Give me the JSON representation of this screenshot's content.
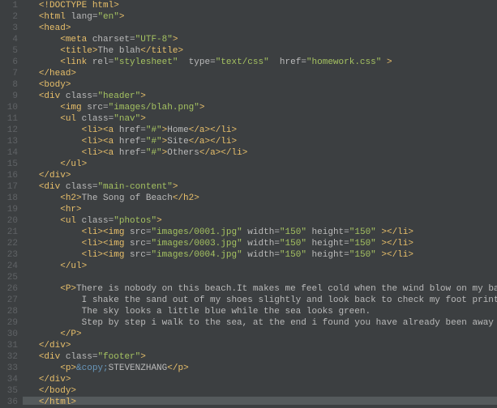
{
  "file": {
    "line_count": 36,
    "current_line": 36
  },
  "code_lines": [
    {
      "indent": 0,
      "tokens": [
        [
          "t-tag",
          "<!DOCTYPE html>"
        ]
      ]
    },
    {
      "indent": 0,
      "tokens": [
        [
          "t-tag",
          "<html "
        ],
        [
          "t-attr",
          "lang"
        ],
        [
          "t-eq",
          "="
        ],
        [
          "t-val",
          "\"en\""
        ],
        [
          "t-tag",
          ">"
        ]
      ]
    },
    {
      "indent": 0,
      "tokens": [
        [
          "t-tag",
          "<head>"
        ]
      ]
    },
    {
      "indent": 1,
      "tokens": [
        [
          "t-tag",
          "<meta "
        ],
        [
          "t-attr",
          "charset"
        ],
        [
          "t-eq",
          "="
        ],
        [
          "t-val",
          "\"UTF-8\""
        ],
        [
          "t-tag",
          ">"
        ]
      ]
    },
    {
      "indent": 1,
      "tokens": [
        [
          "t-tag",
          "<title>"
        ],
        [
          "t-text",
          "The blah"
        ],
        [
          "t-tag",
          "</title>"
        ]
      ]
    },
    {
      "indent": 1,
      "tokens": [
        [
          "t-tag",
          "<link "
        ],
        [
          "t-attr",
          "rel"
        ],
        [
          "t-eq",
          "="
        ],
        [
          "t-val",
          "\"stylesheet\""
        ],
        [
          "t-tag",
          "  "
        ],
        [
          "t-attr",
          "type"
        ],
        [
          "t-eq",
          "="
        ],
        [
          "t-val",
          "\"text/css\""
        ],
        [
          "t-tag",
          "  "
        ],
        [
          "t-attr",
          "href"
        ],
        [
          "t-eq",
          "="
        ],
        [
          "t-val",
          "\"homework.css\""
        ],
        [
          "t-tag",
          " >"
        ]
      ]
    },
    {
      "indent": 0,
      "tokens": [
        [
          "t-tag",
          "</head>"
        ]
      ]
    },
    {
      "indent": 0,
      "tokens": [
        [
          "t-tag",
          "<body>"
        ]
      ]
    },
    {
      "indent": 0,
      "tokens": [
        [
          "t-tag",
          "<div "
        ],
        [
          "t-attr",
          "class"
        ],
        [
          "t-eq",
          "="
        ],
        [
          "t-val",
          "\"header\""
        ],
        [
          "t-tag",
          ">"
        ]
      ]
    },
    {
      "indent": 1,
      "tokens": [
        [
          "t-tag",
          "<img "
        ],
        [
          "t-attr",
          "src"
        ],
        [
          "t-eq",
          "="
        ],
        [
          "t-val",
          "\"images/blah.png\""
        ],
        [
          "t-tag",
          ">"
        ]
      ]
    },
    {
      "indent": 1,
      "tokens": [
        [
          "t-tag",
          "<ul "
        ],
        [
          "t-attr",
          "class"
        ],
        [
          "t-eq",
          "="
        ],
        [
          "t-val",
          "\"nav\""
        ],
        [
          "t-tag",
          ">"
        ]
      ]
    },
    {
      "indent": 2,
      "tokens": [
        [
          "t-tag",
          "<li><a "
        ],
        [
          "t-attr",
          "href"
        ],
        [
          "t-eq",
          "="
        ],
        [
          "t-val",
          "\"#\""
        ],
        [
          "t-tag",
          ">"
        ],
        [
          "t-text",
          "Home"
        ],
        [
          "t-tag",
          "</a></li>"
        ]
      ]
    },
    {
      "indent": 2,
      "tokens": [
        [
          "t-tag",
          "<li><a "
        ],
        [
          "t-attr",
          "href"
        ],
        [
          "t-eq",
          "="
        ],
        [
          "t-val",
          "\"#\""
        ],
        [
          "t-tag",
          ">"
        ],
        [
          "t-text",
          "Site"
        ],
        [
          "t-tag",
          "</a></li>"
        ]
      ]
    },
    {
      "indent": 2,
      "tokens": [
        [
          "t-tag",
          "<li><a "
        ],
        [
          "t-attr",
          "href"
        ],
        [
          "t-eq",
          "="
        ],
        [
          "t-val",
          "\"#\""
        ],
        [
          "t-tag",
          ">"
        ],
        [
          "t-text",
          "Others"
        ],
        [
          "t-tag",
          "</a></li>"
        ]
      ]
    },
    {
      "indent": 1,
      "tokens": [
        [
          "t-tag",
          "</ul>"
        ]
      ]
    },
    {
      "indent": 0,
      "tokens": [
        [
          "t-tag",
          "</div>"
        ]
      ]
    },
    {
      "indent": 0,
      "tokens": [
        [
          "t-tag",
          "<div "
        ],
        [
          "t-attr",
          "class"
        ],
        [
          "t-eq",
          "="
        ],
        [
          "t-val",
          "\"main-content\""
        ],
        [
          "t-tag",
          ">"
        ]
      ]
    },
    {
      "indent": 1,
      "tokens": [
        [
          "t-tag",
          "<h2>"
        ],
        [
          "t-text",
          "The Song of Beach"
        ],
        [
          "t-tag",
          "</h2>"
        ]
      ]
    },
    {
      "indent": 1,
      "tokens": [
        [
          "t-tag",
          "<hr>"
        ]
      ]
    },
    {
      "indent": 1,
      "tokens": [
        [
          "t-tag",
          "<ul "
        ],
        [
          "t-attr",
          "class"
        ],
        [
          "t-eq",
          "="
        ],
        [
          "t-val",
          "\"photos\""
        ],
        [
          "t-tag",
          ">"
        ]
      ]
    },
    {
      "indent": 2,
      "tokens": [
        [
          "t-tag",
          "<li><img "
        ],
        [
          "t-attr",
          "src"
        ],
        [
          "t-eq",
          "="
        ],
        [
          "t-val",
          "\"images/0001.jpg\""
        ],
        [
          "t-tag",
          " "
        ],
        [
          "t-attr",
          "width"
        ],
        [
          "t-eq",
          "="
        ],
        [
          "t-val",
          "\"150\""
        ],
        [
          "t-tag",
          " "
        ],
        [
          "t-attr",
          "height"
        ],
        [
          "t-eq",
          "="
        ],
        [
          "t-val",
          "\"150\""
        ],
        [
          "t-tag",
          " ></li>"
        ]
      ]
    },
    {
      "indent": 2,
      "tokens": [
        [
          "t-tag",
          "<li><img "
        ],
        [
          "t-attr",
          "src"
        ],
        [
          "t-eq",
          "="
        ],
        [
          "t-val",
          "\"images/0003.jpg\""
        ],
        [
          "t-tag",
          " "
        ],
        [
          "t-attr",
          "width"
        ],
        [
          "t-eq",
          "="
        ],
        [
          "t-val",
          "\"150\""
        ],
        [
          "t-tag",
          " "
        ],
        [
          "t-attr",
          "height"
        ],
        [
          "t-eq",
          "="
        ],
        [
          "t-val",
          "\"150\""
        ],
        [
          "t-tag",
          " ></li>"
        ]
      ]
    },
    {
      "indent": 2,
      "tokens": [
        [
          "t-tag",
          "<li><img "
        ],
        [
          "t-attr",
          "src"
        ],
        [
          "t-eq",
          "="
        ],
        [
          "t-val",
          "\"images/0004.jpg\""
        ],
        [
          "t-tag",
          " "
        ],
        [
          "t-attr",
          "width"
        ],
        [
          "t-eq",
          "="
        ],
        [
          "t-val",
          "\"150\""
        ],
        [
          "t-tag",
          " "
        ],
        [
          "t-attr",
          "height"
        ],
        [
          "t-eq",
          "="
        ],
        [
          "t-val",
          "\"150\""
        ],
        [
          "t-tag",
          " ></li>"
        ]
      ]
    },
    {
      "indent": 1,
      "tokens": [
        [
          "t-tag",
          "</ul>"
        ]
      ]
    },
    {
      "indent": 0,
      "tokens": []
    },
    {
      "indent": 1,
      "tokens": [
        [
          "t-tag",
          "<P>"
        ],
        [
          "t-text",
          "There is nobody on this beach.It makes me feel cold when the wind blow on my back."
        ]
      ]
    },
    {
      "indent": 2,
      "tokens": [
        [
          "t-text",
          "I shake the sand out of my shoes slightly and look back to check my foot prints."
        ]
      ]
    },
    {
      "indent": 2,
      "tokens": [
        [
          "t-text",
          "The sky looks a little blue while the sea looks green."
        ]
      ]
    },
    {
      "indent": 2,
      "tokens": [
        [
          "t-text",
          "Step by step i walk to the sea, at the end i found you have already been away from me."
        ]
      ]
    },
    {
      "indent": 1,
      "tokens": [
        [
          "t-tag",
          "</P>"
        ]
      ]
    },
    {
      "indent": 0,
      "tokens": [
        [
          "t-tag",
          "</div>"
        ]
      ]
    },
    {
      "indent": 0,
      "tokens": [
        [
          "t-tag",
          "<div "
        ],
        [
          "t-attr",
          "class"
        ],
        [
          "t-eq",
          "="
        ],
        [
          "t-val",
          "\"footer\""
        ],
        [
          "t-tag",
          ">"
        ]
      ]
    },
    {
      "indent": 1,
      "tokens": [
        [
          "t-tag",
          "<p>"
        ],
        [
          "t-entity",
          "&copy;"
        ],
        [
          "t-text",
          "STEVENZHANG"
        ],
        [
          "t-tag",
          "</p>"
        ]
      ]
    },
    {
      "indent": 0,
      "tokens": [
        [
          "t-tag",
          "</div>"
        ]
      ]
    },
    {
      "indent": 0,
      "tokens": [
        [
          "t-tag",
          "</body>"
        ]
      ]
    },
    {
      "indent": 0,
      "tokens": [
        [
          "t-tag",
          "</html>"
        ]
      ]
    }
  ]
}
